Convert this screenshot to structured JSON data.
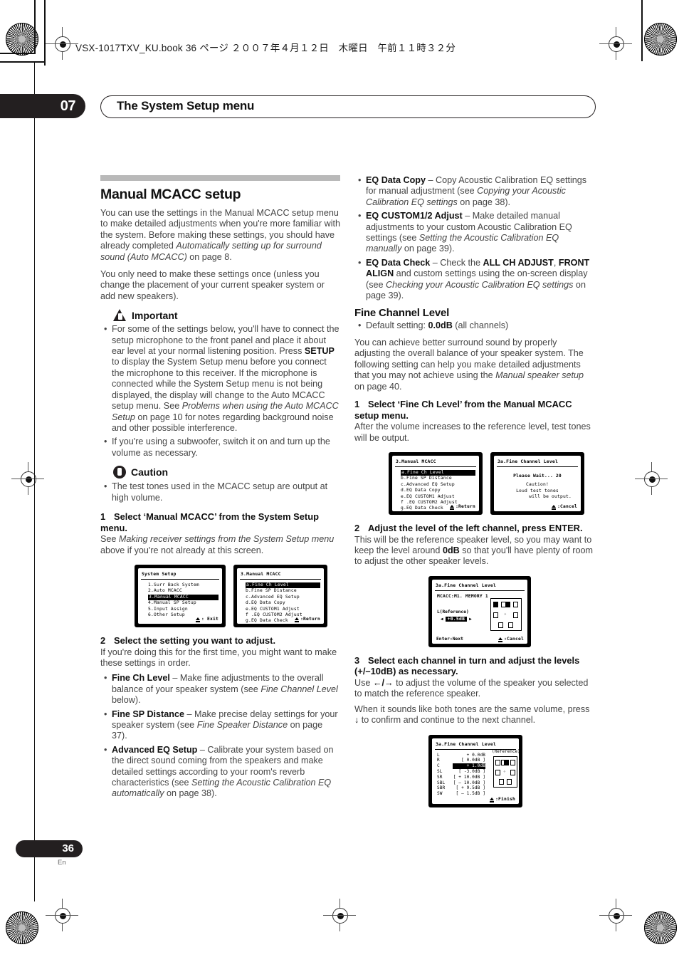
{
  "book_header": "VSX-1017TXV_KU.book  36 ページ  ２００７年４月１２日　木曜日　午前１１時３２分",
  "chapter": {
    "number": "07",
    "title": "The System Setup menu"
  },
  "footer": {
    "page": "36",
    "lang": "En"
  },
  "left": {
    "section_title": "Manual MCACC setup",
    "intro_p1_a": "You can use the settings in the Manual MCACC setup menu to make detailed adjustments when you're more familiar with the system. Before making these settings, you should have already completed ",
    "intro_p1_em": "Automatically setting up for surround sound (Auto MCACC)",
    "intro_p1_b": " on page 8.",
    "intro_p2": "You only need to make these settings once (unless you change the placement of your current speaker system or add new speakers).",
    "important_label": "Important",
    "important_b1_a": "For some of the settings below, you'll have to connect the setup microphone to the front panel and place it about ear level at your normal listening position. Press ",
    "important_b1_bold": "SETUP",
    "important_b1_b": " to display the System Setup menu before you connect the microphone to this receiver. If the microphone is connected while the System Setup menu is not being displayed, the display will change to the Auto MCACC setup menu. See ",
    "important_b1_em": "Problems when using the Auto MCACC Setup",
    "important_b1_c": " on page 10 for notes regarding background noise and other possible interference.",
    "important_b2": "If you're using a subwoofer, switch it on and turn up the volume as necessary.",
    "caution_label": "Caution",
    "caution_b1": "The test tones used in the MCACC setup are output at high volume.",
    "step1_num": "1",
    "step1_title": "Select ‘Manual MCACC’ from the System Setup menu.",
    "step1_body_a": "See ",
    "step1_body_em": "Making receiver settings from the System Setup menu",
    "step1_body_b": " above if you're not already at this screen.",
    "step2_num": "2",
    "step2_title": "Select the setting you want to adjust.",
    "step2_body": "If you're doing this for the first time, you might want to make these settings in order.",
    "bullets": [
      {
        "bold": "Fine Ch Level",
        "text_a": " – Make fine adjustments to the overall balance of your speaker system (see ",
        "em": "Fine Channel Level",
        "text_b": " below)."
      },
      {
        "bold": "Fine SP Distance",
        "text_a": " – Make precise delay settings for your speaker system (see ",
        "em": "Fine Speaker Distance",
        "text_b": " on page 37)."
      },
      {
        "bold": "Advanced EQ Setup",
        "text_a": " – Calibrate your system based on the direct sound coming from the speakers and make detailed settings according to your room's reverb characteristics (see ",
        "em": "Setting the Acoustic Calibration EQ automatically",
        "text_b": " on page 38)."
      }
    ]
  },
  "right": {
    "bullets": [
      {
        "bold": "EQ Data Copy",
        "text_a": " – Copy Acoustic Calibration EQ settings for manual adjustment (see ",
        "em": "Copying your Acoustic Calibration EQ settings",
        "text_b": " on page 38)."
      },
      {
        "bold": "EQ CUSTOM1/2 Adjust",
        "text_a": " – Make detailed manual adjustments to your custom Acoustic Calibration EQ settings (see ",
        "em": "Setting the Acoustic Calibration EQ manually",
        "text_b": " on page 39)."
      }
    ],
    "bullet3": {
      "bold": "EQ Data Check",
      "text_a": " – Check the ",
      "bold2": "ALL CH ADJUST",
      "text_b": ", ",
      "bold3": "FRONT ALIGN",
      "text_c": " and custom settings using the on-screen display (see ",
      "em": "Checking your Acoustic Calibration EQ settings",
      "text_d": " on page 39)."
    },
    "section_title": "Fine Channel Level",
    "default_a": "Default setting: ",
    "default_bold": "0.0dB",
    "default_b": " (all channels)",
    "intro_a": "You can achieve better surround sound by properly adjusting the overall balance of your speaker system. The following setting can help you make detailed adjustments that you may not achieve using the ",
    "intro_em": "Manual speaker setup",
    "intro_b": " on page 40.",
    "step1_num": "1",
    "step1_title": "Select ‘Fine Ch Level’ from the Manual MCACC setup menu.",
    "step1_body": "After the volume increases to the reference level, test tones will be output.",
    "step2_num": "2",
    "step2_title": "Adjust the level of the left channel, press ENTER.",
    "step2_body_a": "This will be the reference speaker level, so you may want to keep the level around ",
    "step2_bold": "0dB",
    "step2_body_b": " so that you'll have plenty of room to adjust the other speaker levels.",
    "step3_num": "3",
    "step3_title": "Select each channel in turn and adjust the levels (+/–10dB) as necessary.",
    "step3_body_a": "Use ",
    "step3_arrows": "←/→",
    "step3_body_b": " to adjust the volume of the speaker you selected to match the reference speaker.",
    "step3_p2_a": "When it sounds like both tones are the same volume, press ",
    "step3_p2_arrow": "↓",
    "step3_p2_b": " to confirm and continue to the next channel."
  },
  "osd": {
    "system_setup": {
      "title": "System  Setup",
      "items": [
        "1.Surr  Back  System",
        "2.Auto  MCACC",
        "3.Manual  MCACC",
        "4.Manual  SP  Setup",
        "5.Input  Assign",
        "6.Other  Setup"
      ],
      "selected_index": 2,
      "footer": ": Exit"
    },
    "manual_mcacc": {
      "title": "3.Manual  MCACC",
      "items": [
        "a.Fine  Ch  Level",
        "b.Fine  SP  Distance",
        "c.Advanced EQ Setup",
        "d.EQ  Data  Copy",
        "e.EQ  CUSTOM1  Adjust",
        "f .EQ  CUSTOM2  Adjust",
        "g.EQ  Data  Check"
      ],
      "selected_index": 0,
      "footer": ":Return"
    },
    "please_wait": {
      "title": "3a.Fine  Channel  Level",
      "line1": "Please  Wait...   20",
      "line2": "Caution!",
      "line3": "Loud test tones",
      "line4": "will be output.",
      "footer": ":Cancel"
    },
    "left_level": {
      "title": "3a.Fine  Channel  Level",
      "memory": "MCACC:M1. MEMORY  1",
      "channel_label": "L(Reference)",
      "value": "+0.5dB",
      "left_arrow": "◀",
      "right_arrow": "▶",
      "footer_left": "Enter:Next",
      "footer_right": ":Cancel"
    },
    "all_channels": {
      "title": "3a.Fine  Channel  Level",
      "reference_note": "(Reference)",
      "rows": [
        {
          "ch": "L",
          "val": "+   0.0dB",
          "bracket": false,
          "selected": false
        },
        {
          "ch": "R",
          "val": "[   0.0dB ]",
          "bracket": true,
          "selected": false
        },
        {
          "ch": "C",
          "val": "+   1.0dB",
          "bracket": true,
          "selected": true
        },
        {
          "ch": "SL",
          "val": "[  -3.0dB ]",
          "bracket": true,
          "selected": false
        },
        {
          "ch": "SR",
          "val": "[ + 10.0dB ]",
          "bracket": true,
          "selected": false
        },
        {
          "ch": "SBL",
          "val": "[ – 10.0dB ]",
          "bracket": true,
          "selected": false
        },
        {
          "ch": "SBR",
          "val": "[ +  9.5dB ]",
          "bracket": true,
          "selected": false
        },
        {
          "ch": "SW",
          "val": "[ –  1.5dB ]",
          "bracket": true,
          "selected": false
        }
      ],
      "footer": ":Finish"
    }
  }
}
